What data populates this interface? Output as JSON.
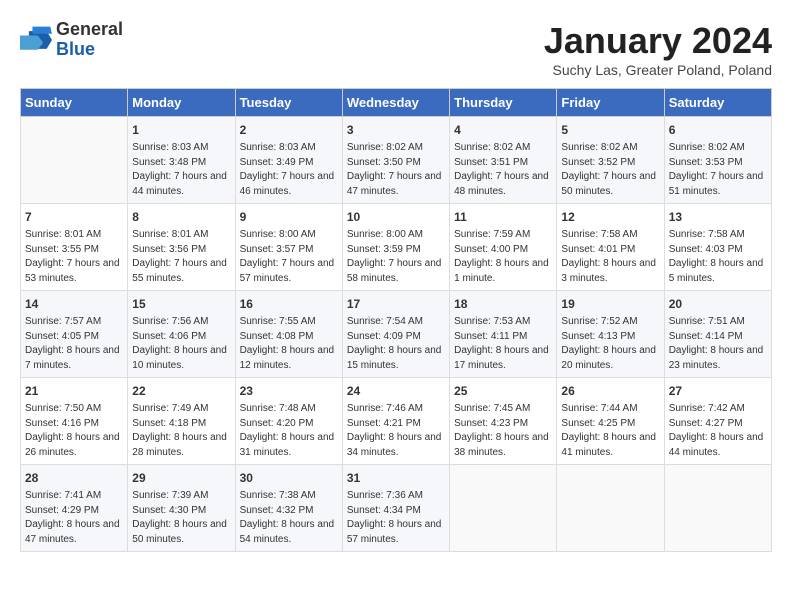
{
  "header": {
    "logo_general": "General",
    "logo_blue": "Blue",
    "month_title": "January 2024",
    "subtitle": "Suchy Las, Greater Poland, Poland"
  },
  "weekdays": [
    "Sunday",
    "Monday",
    "Tuesday",
    "Wednesday",
    "Thursday",
    "Friday",
    "Saturday"
  ],
  "weeks": [
    [
      {
        "day": "",
        "sunrise": "",
        "sunset": "",
        "daylight": ""
      },
      {
        "day": "1",
        "sunrise": "Sunrise: 8:03 AM",
        "sunset": "Sunset: 3:48 PM",
        "daylight": "Daylight: 7 hours and 44 minutes."
      },
      {
        "day": "2",
        "sunrise": "Sunrise: 8:03 AM",
        "sunset": "Sunset: 3:49 PM",
        "daylight": "Daylight: 7 hours and 46 minutes."
      },
      {
        "day": "3",
        "sunrise": "Sunrise: 8:02 AM",
        "sunset": "Sunset: 3:50 PM",
        "daylight": "Daylight: 7 hours and 47 minutes."
      },
      {
        "day": "4",
        "sunrise": "Sunrise: 8:02 AM",
        "sunset": "Sunset: 3:51 PM",
        "daylight": "Daylight: 7 hours and 48 minutes."
      },
      {
        "day": "5",
        "sunrise": "Sunrise: 8:02 AM",
        "sunset": "Sunset: 3:52 PM",
        "daylight": "Daylight: 7 hours and 50 minutes."
      },
      {
        "day": "6",
        "sunrise": "Sunrise: 8:02 AM",
        "sunset": "Sunset: 3:53 PM",
        "daylight": "Daylight: 7 hours and 51 minutes."
      }
    ],
    [
      {
        "day": "7",
        "sunrise": "Sunrise: 8:01 AM",
        "sunset": "Sunset: 3:55 PM",
        "daylight": "Daylight: 7 hours and 53 minutes."
      },
      {
        "day": "8",
        "sunrise": "Sunrise: 8:01 AM",
        "sunset": "Sunset: 3:56 PM",
        "daylight": "Daylight: 7 hours and 55 minutes."
      },
      {
        "day": "9",
        "sunrise": "Sunrise: 8:00 AM",
        "sunset": "Sunset: 3:57 PM",
        "daylight": "Daylight: 7 hours and 57 minutes."
      },
      {
        "day": "10",
        "sunrise": "Sunrise: 8:00 AM",
        "sunset": "Sunset: 3:59 PM",
        "daylight": "Daylight: 7 hours and 58 minutes."
      },
      {
        "day": "11",
        "sunrise": "Sunrise: 7:59 AM",
        "sunset": "Sunset: 4:00 PM",
        "daylight": "Daylight: 8 hours and 1 minute."
      },
      {
        "day": "12",
        "sunrise": "Sunrise: 7:58 AM",
        "sunset": "Sunset: 4:01 PM",
        "daylight": "Daylight: 8 hours and 3 minutes."
      },
      {
        "day": "13",
        "sunrise": "Sunrise: 7:58 AM",
        "sunset": "Sunset: 4:03 PM",
        "daylight": "Daylight: 8 hours and 5 minutes."
      }
    ],
    [
      {
        "day": "14",
        "sunrise": "Sunrise: 7:57 AM",
        "sunset": "Sunset: 4:05 PM",
        "daylight": "Daylight: 8 hours and 7 minutes."
      },
      {
        "day": "15",
        "sunrise": "Sunrise: 7:56 AM",
        "sunset": "Sunset: 4:06 PM",
        "daylight": "Daylight: 8 hours and 10 minutes."
      },
      {
        "day": "16",
        "sunrise": "Sunrise: 7:55 AM",
        "sunset": "Sunset: 4:08 PM",
        "daylight": "Daylight: 8 hours and 12 minutes."
      },
      {
        "day": "17",
        "sunrise": "Sunrise: 7:54 AM",
        "sunset": "Sunset: 4:09 PM",
        "daylight": "Daylight: 8 hours and 15 minutes."
      },
      {
        "day": "18",
        "sunrise": "Sunrise: 7:53 AM",
        "sunset": "Sunset: 4:11 PM",
        "daylight": "Daylight: 8 hours and 17 minutes."
      },
      {
        "day": "19",
        "sunrise": "Sunrise: 7:52 AM",
        "sunset": "Sunset: 4:13 PM",
        "daylight": "Daylight: 8 hours and 20 minutes."
      },
      {
        "day": "20",
        "sunrise": "Sunrise: 7:51 AM",
        "sunset": "Sunset: 4:14 PM",
        "daylight": "Daylight: 8 hours and 23 minutes."
      }
    ],
    [
      {
        "day": "21",
        "sunrise": "Sunrise: 7:50 AM",
        "sunset": "Sunset: 4:16 PM",
        "daylight": "Daylight: 8 hours and 26 minutes."
      },
      {
        "day": "22",
        "sunrise": "Sunrise: 7:49 AM",
        "sunset": "Sunset: 4:18 PM",
        "daylight": "Daylight: 8 hours and 28 minutes."
      },
      {
        "day": "23",
        "sunrise": "Sunrise: 7:48 AM",
        "sunset": "Sunset: 4:20 PM",
        "daylight": "Daylight: 8 hours and 31 minutes."
      },
      {
        "day": "24",
        "sunrise": "Sunrise: 7:46 AM",
        "sunset": "Sunset: 4:21 PM",
        "daylight": "Daylight: 8 hours and 34 minutes."
      },
      {
        "day": "25",
        "sunrise": "Sunrise: 7:45 AM",
        "sunset": "Sunset: 4:23 PM",
        "daylight": "Daylight: 8 hours and 38 minutes."
      },
      {
        "day": "26",
        "sunrise": "Sunrise: 7:44 AM",
        "sunset": "Sunset: 4:25 PM",
        "daylight": "Daylight: 8 hours and 41 minutes."
      },
      {
        "day": "27",
        "sunrise": "Sunrise: 7:42 AM",
        "sunset": "Sunset: 4:27 PM",
        "daylight": "Daylight: 8 hours and 44 minutes."
      }
    ],
    [
      {
        "day": "28",
        "sunrise": "Sunrise: 7:41 AM",
        "sunset": "Sunset: 4:29 PM",
        "daylight": "Daylight: 8 hours and 47 minutes."
      },
      {
        "day": "29",
        "sunrise": "Sunrise: 7:39 AM",
        "sunset": "Sunset: 4:30 PM",
        "daylight": "Daylight: 8 hours and 50 minutes."
      },
      {
        "day": "30",
        "sunrise": "Sunrise: 7:38 AM",
        "sunset": "Sunset: 4:32 PM",
        "daylight": "Daylight: 8 hours and 54 minutes."
      },
      {
        "day": "31",
        "sunrise": "Sunrise: 7:36 AM",
        "sunset": "Sunset: 4:34 PM",
        "daylight": "Daylight: 8 hours and 57 minutes."
      },
      {
        "day": "",
        "sunrise": "",
        "sunset": "",
        "daylight": ""
      },
      {
        "day": "",
        "sunrise": "",
        "sunset": "",
        "daylight": ""
      },
      {
        "day": "",
        "sunrise": "",
        "sunset": "",
        "daylight": ""
      }
    ]
  ]
}
